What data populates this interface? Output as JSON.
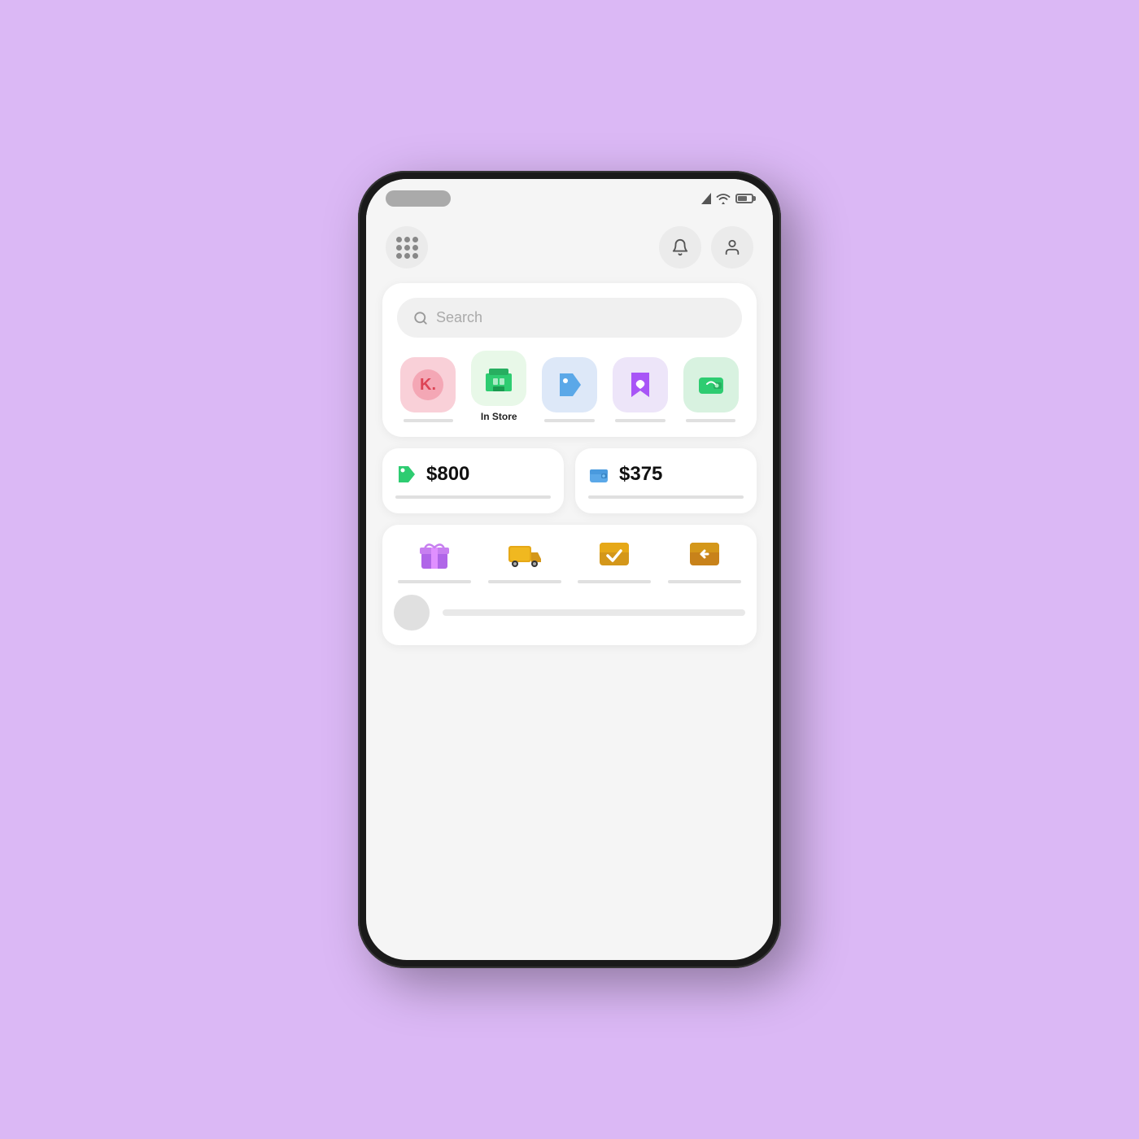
{
  "background_color": "#dbb8f5",
  "phone": {
    "status_bar": {
      "notch_label": "notch",
      "signal_label": "signal",
      "wifi_label": "wifi",
      "battery_label": "battery"
    },
    "header": {
      "grid_button_label": "apps",
      "notification_button_label": "notifications",
      "profile_button_label": "profile"
    },
    "search": {
      "placeholder": "Search",
      "card_label": "search-card"
    },
    "categories": [
      {
        "id": "k-brand",
        "label": "",
        "emoji": "🅺",
        "color_class": "cat-pink",
        "has_label": false
      },
      {
        "id": "in-store",
        "label": "In Store",
        "emoji": "🏪",
        "color_class": "cat-green",
        "has_label": true
      },
      {
        "id": "tag",
        "label": "",
        "emoji": "🏷️",
        "color_class": "cat-blue-light",
        "has_label": false
      },
      {
        "id": "bookmark",
        "label": "",
        "emoji": "🔖",
        "color_class": "cat-purple-light",
        "has_label": false
      },
      {
        "id": "wallet",
        "label": "",
        "emoji": "💚",
        "color_class": "cat-green2",
        "has_label": false
      }
    ],
    "money_cards": [
      {
        "id": "card1",
        "amount": "$800",
        "icon": "🏷️"
      },
      {
        "id": "card2",
        "amount": "$375",
        "icon": "👛"
      }
    ],
    "delivery_items": [
      {
        "id": "gift",
        "icon": "🎁"
      },
      {
        "id": "truck",
        "icon": "🚚"
      },
      {
        "id": "check-box",
        "icon": "📦"
      },
      {
        "id": "return-box",
        "icon": "📦"
      }
    ]
  }
}
